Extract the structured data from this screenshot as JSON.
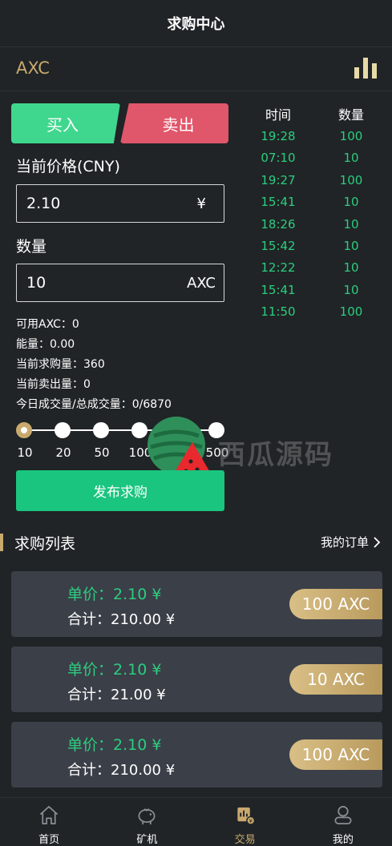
{
  "header": {
    "title": "求购中心"
  },
  "coin": {
    "symbol": "AXC",
    "chart_icon": "bar-chart-icon"
  },
  "tabs": {
    "buy": "买入",
    "sell": "卖出"
  },
  "form": {
    "price_label": "当前价格(CNY)",
    "price_value": "2.10",
    "price_unit": "¥",
    "qty_label": "数量",
    "qty_value": "10",
    "qty_unit": "AXC"
  },
  "stats": {
    "available": "可用AXC：0",
    "energy": "能量：0.00",
    "buy_volume": "当前求购量：360",
    "sell_volume": "当前卖出量：0",
    "today_total": "今日成交量/总成交量：0/6870"
  },
  "slider": {
    "ticks": [
      "10",
      "20",
      "50",
      "100",
      "200",
      "500"
    ],
    "selected": "10"
  },
  "publish_label": "发布求购",
  "trades": {
    "time_header": "时间",
    "qty_header": "数量",
    "rows": [
      {
        "time": "19:28",
        "qty": "100"
      },
      {
        "time": "07:10",
        "qty": "10"
      },
      {
        "time": "19:27",
        "qty": "100"
      },
      {
        "time": "15:41",
        "qty": "10"
      },
      {
        "time": "18:26",
        "qty": "10"
      },
      {
        "time": "15:42",
        "qty": "10"
      },
      {
        "time": "12:22",
        "qty": "10"
      },
      {
        "time": "15:41",
        "qty": "10"
      },
      {
        "time": "11:50",
        "qty": "100"
      }
    ]
  },
  "list": {
    "title": "求购列表",
    "my_orders": "我的订单",
    "orders": [
      {
        "price": "单价：2.10 ¥",
        "total": "合计：210.00 ¥",
        "qty": "100 AXC"
      },
      {
        "price": "单价：2.10 ¥",
        "total": "合计：21.00 ¥",
        "qty": "10 AXC"
      },
      {
        "price": "单价：2.10 ¥",
        "total": "合计：210.00 ¥",
        "qty": "100 AXC"
      }
    ]
  },
  "watermark": {
    "text": "西瓜源码"
  },
  "tabbar": [
    {
      "label": "首页",
      "icon": "home-icon"
    },
    {
      "label": "矿机",
      "icon": "piggy-bank-icon"
    },
    {
      "label": "交易",
      "icon": "trade-icon"
    },
    {
      "label": "我的",
      "icon": "user-icon"
    }
  ],
  "colors": {
    "accent_gold": "#c9a96e",
    "buy_green": "#3fd78e",
    "sell_red": "#e0566a",
    "text_green": "#2ccd7f",
    "background": "#202426"
  }
}
